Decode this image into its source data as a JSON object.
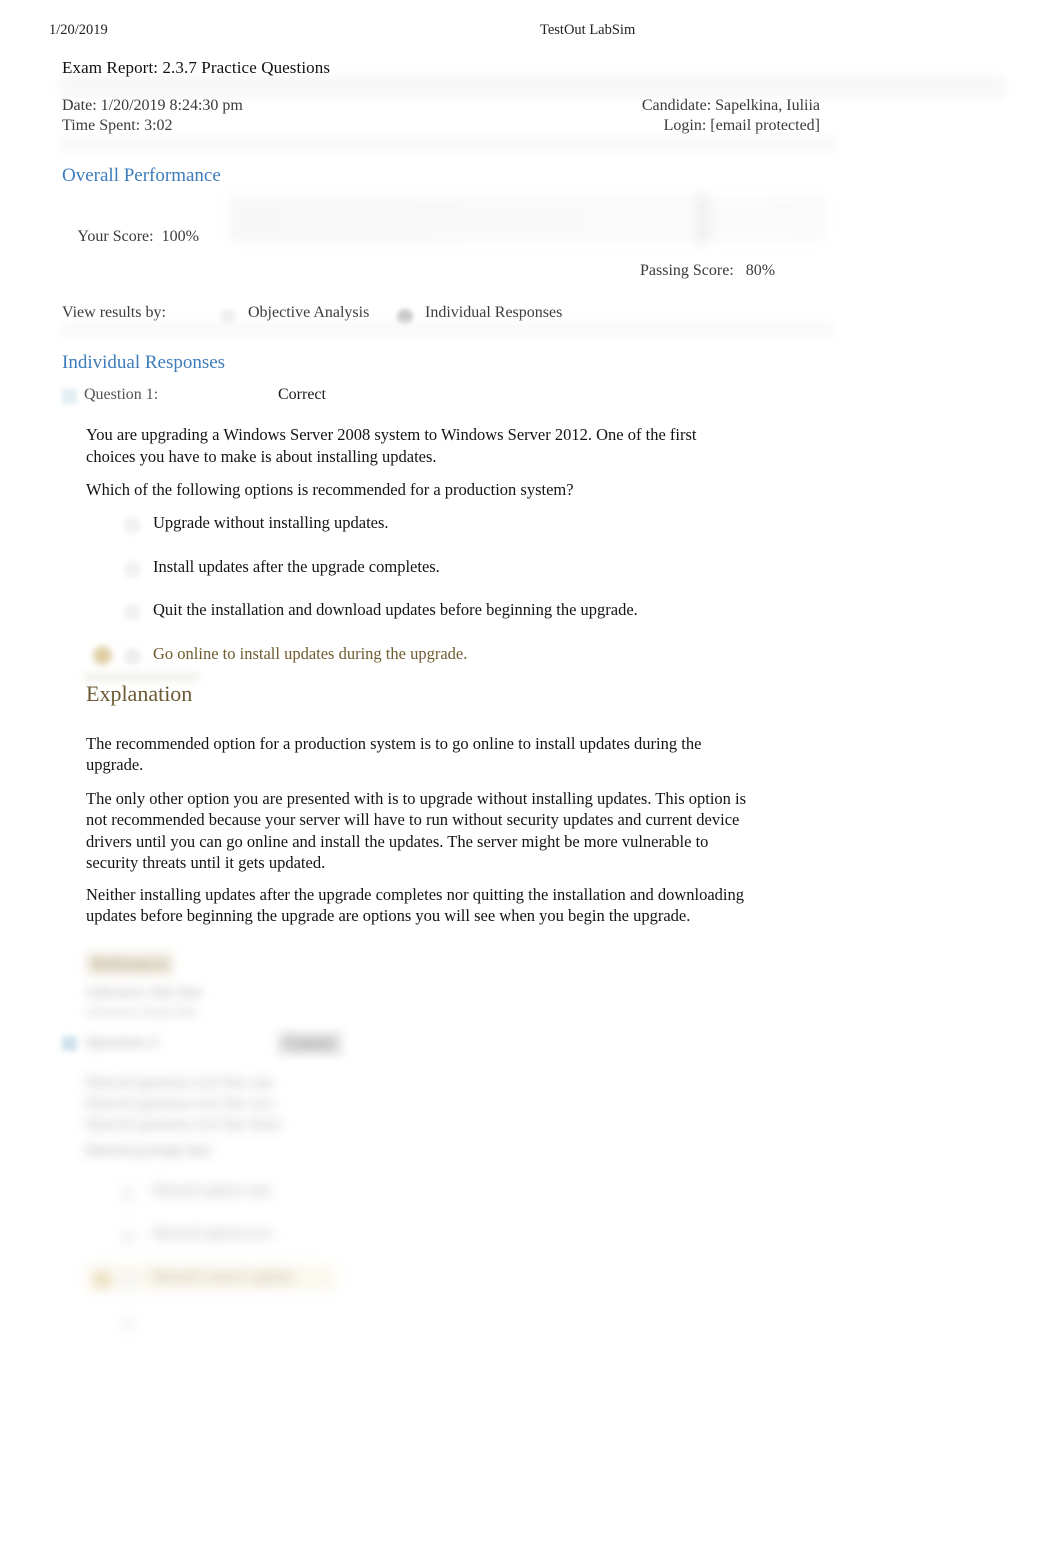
{
  "print_header": {
    "date": "1/20/2019",
    "app_name": "TestOut LabSim"
  },
  "report": {
    "title": "Exam Report: 2.3.7 Practice Questions",
    "date_label": "Date: 1/20/2019 8:24:30 pm",
    "time_spent_label": "Time Spent: 3:02",
    "candidate_label": "Candidate: Sapelkina, Iuliia",
    "login_label": "Login: [email protected]"
  },
  "overall_performance": {
    "heading": "Overall Performance",
    "your_score_label": "Your Score:",
    "your_score_value": "100%",
    "passing_score_label": "Passing Score:",
    "passing_score_value": "80%"
  },
  "view_results": {
    "label": "View results by:",
    "options": [
      {
        "label": "Objective Analysis",
        "selected": false
      },
      {
        "label": "Individual Responses",
        "selected": true
      }
    ]
  },
  "individual_responses": {
    "heading": "Individual Responses",
    "questions": [
      {
        "label": "Question 1:",
        "result": "Correct",
        "stem": "You are upgrading a Windows Server 2008 system to Windows Server 2012. One of the first choices you have to make is about installing updates.",
        "prompt": "Which of the following options is recommended for a production system?",
        "answers": [
          {
            "text": "Upgrade without installing updates.",
            "correct": false
          },
          {
            "text": "Install updates after the upgrade completes.",
            "correct": false
          },
          {
            "text": "Quit the installation and download updates before beginning the upgrade.",
            "correct": false
          },
          {
            "text": "Go online to install updates during the upgrade.",
            "correct": true
          }
        ],
        "explanation": {
          "heading": "Explanation",
          "paragraphs": [
            "The recommended option for a production system is to go online to install updates during the upgrade.",
            "The only other option you are presented with is to upgrade without installing updates. This option is not recommended because your server will have to run without security updates and current device drivers until you can go online and install the updates. The server might be more vulnerable to security threats until it gets updated.",
            "Neither installing updates after the upgrade completes nor quitting the installation and downloading updates before beginning the upgrade are options you will see when you begin the upgrade."
          ]
        }
      }
    ]
  },
  "obscured_tail": {
    "note": "content below is blurred/illegible in the source screenshot",
    "references_heading": "References",
    "reference_line_1": "reference title line",
    "reference_line_2": "reference detail line",
    "question_2_label": "Question 2:",
    "question_2_result": "Correct",
    "question_2_stem_line_1": "blurred question text line one",
    "question_2_stem_line_2": "blurred question text line two",
    "question_2_stem_line_3": "blurred question text line three",
    "question_2_prompt": "blurred prompt line",
    "question_2_answers": [
      "blurred option one",
      "blurred option two",
      "blurred correct option",
      ""
    ]
  },
  "colors": {
    "section_heading": "#3c7cba",
    "explanation_heading": "#6b5a32",
    "correct_answer_text": "#6e5c2e",
    "body_text": "#141414",
    "muted_text": "#3a3a3a"
  }
}
